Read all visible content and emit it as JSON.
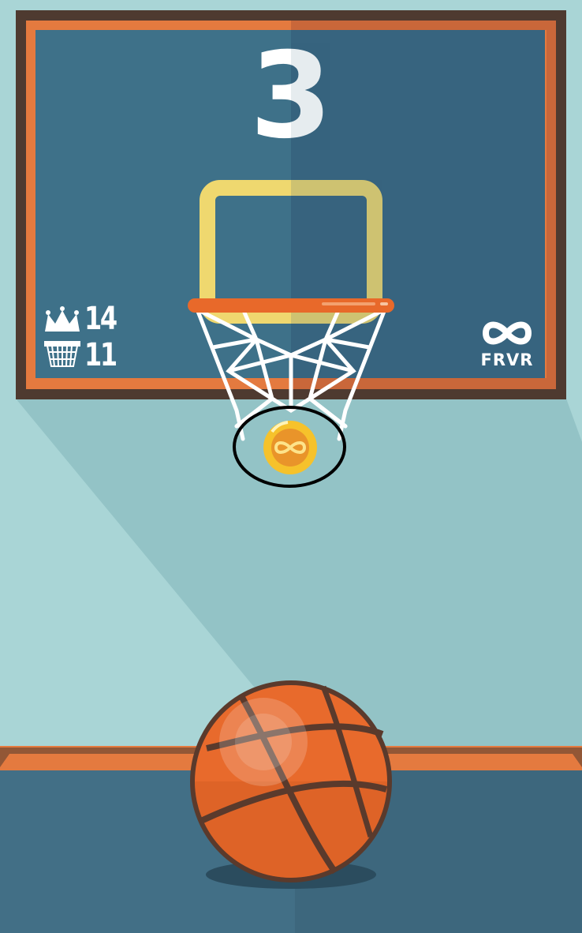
{
  "game": {
    "current_score": "3",
    "best_score": "14",
    "baskets": "11",
    "brand": "FRVR"
  },
  "icons": {
    "best": "crown-icon",
    "baskets": "hoop-net-icon",
    "brand": "infinity-logo-icon",
    "coin": "infinity-coin-icon"
  },
  "colors": {
    "background": "#a9d5d6",
    "board": "#3e7189",
    "board_frame": "#4e3a30",
    "board_trim": "#e47a3f",
    "rim": "#e8692a",
    "square": "#efd86f",
    "ball": "#e86a2c",
    "coin": "#f6c22b",
    "floor": "#426f86"
  }
}
